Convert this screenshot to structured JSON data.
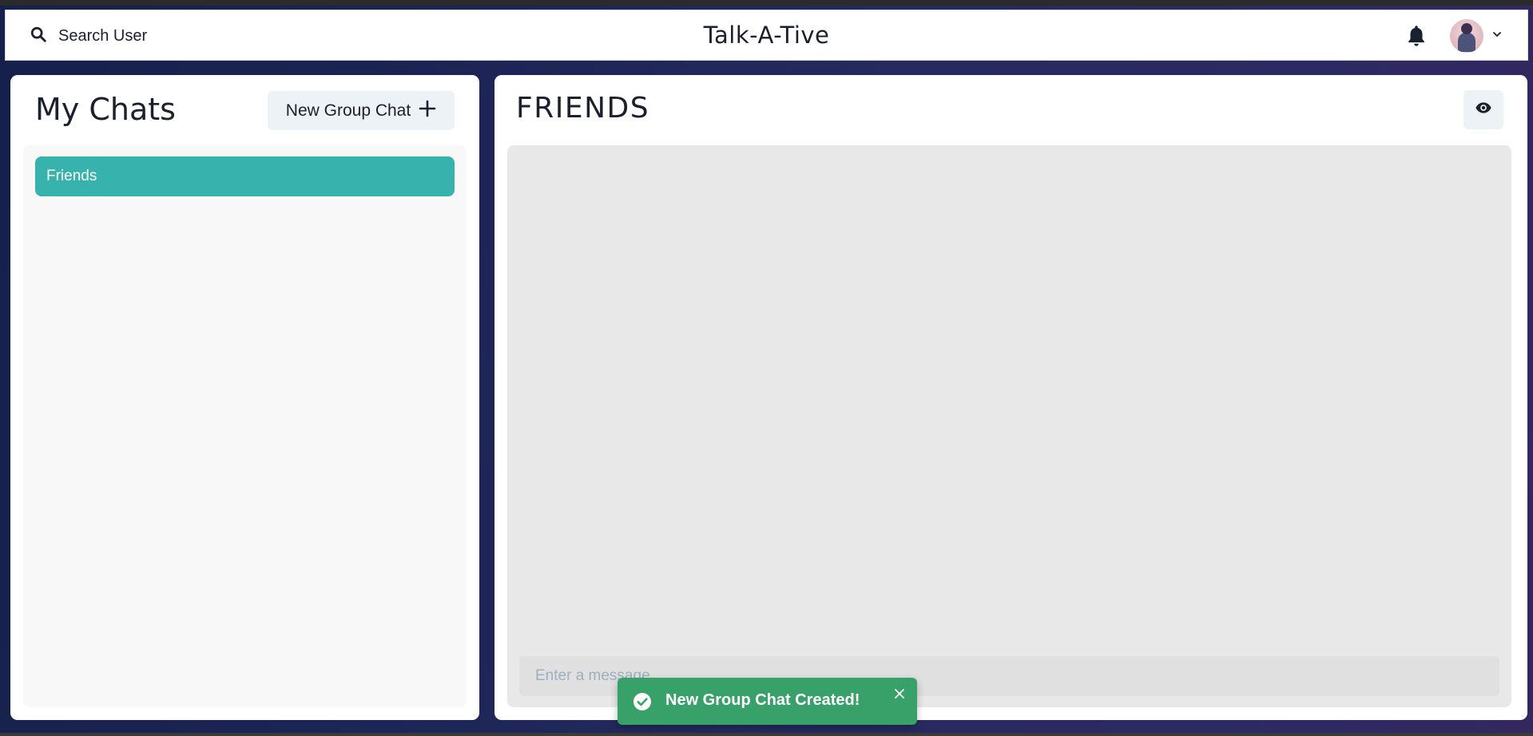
{
  "header": {
    "search_label": "Search User",
    "app_title": "Talk-A-Tive",
    "notification_icon": "bell-icon",
    "avatar_icon": "user-avatar",
    "dropdown_icon": "chevron-down-icon"
  },
  "sidebar": {
    "title": "My Chats",
    "new_group_label": "New Group Chat",
    "new_group_icon": "plus-icon",
    "chats": [
      {
        "name": "Friends",
        "selected": true
      }
    ]
  },
  "chat": {
    "title": "FRIENDS",
    "view_icon": "eye-icon",
    "input_placeholder": "Enter a message..",
    "input_value": ""
  },
  "toast": {
    "message": "New Group Chat Created!",
    "status": "success",
    "icon": "check-circle-icon",
    "close_icon": "close-icon"
  },
  "colors": {
    "accent": "#38b2ac",
    "toast_success": "#38a169",
    "button_bg": "#edf2f7",
    "page_bg": "#1c2555"
  }
}
